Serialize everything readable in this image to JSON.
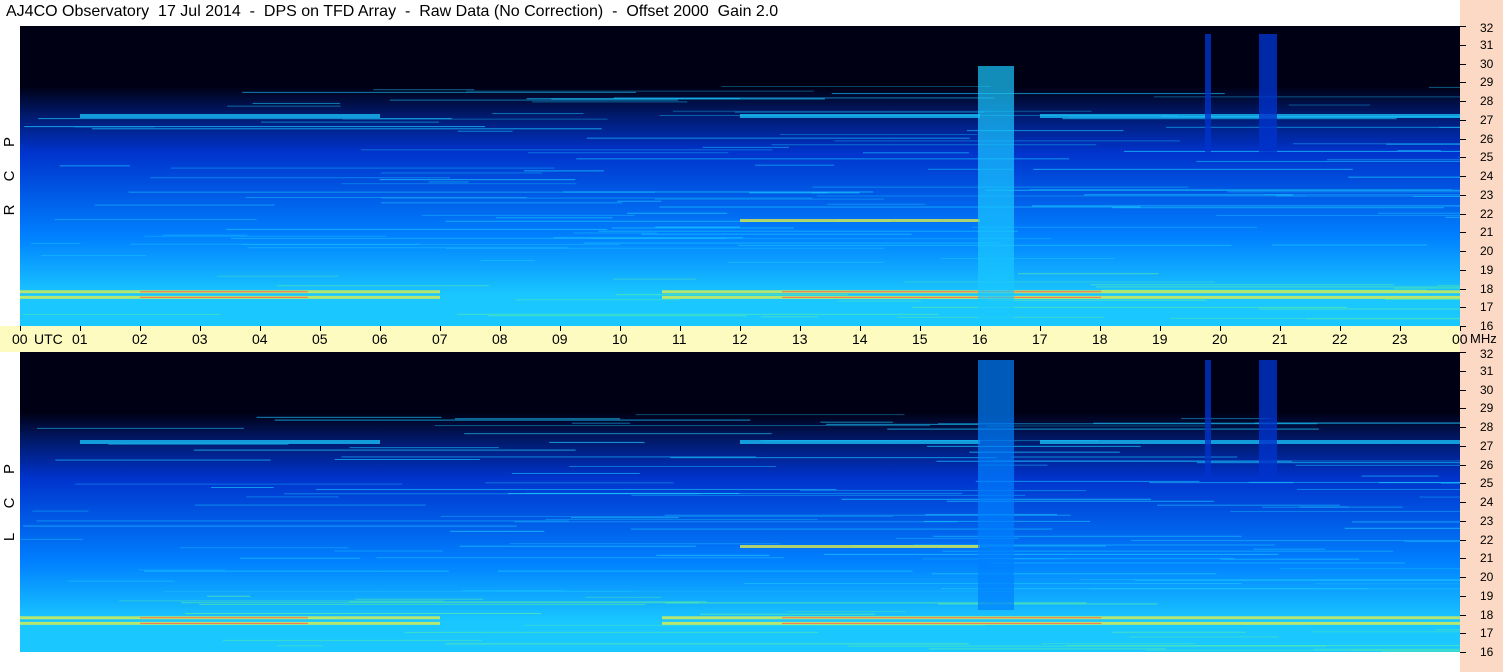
{
  "title": "AJ4CO Observatory  17 Jul 2014  -  DPS on TFD Array  -  Raw Data (No Correction)  -  Offset 2000  Gain 2.0",
  "chart_data": {
    "type": "heatmap",
    "title": "AJ4CO Observatory  17 Jul 2014  -  DPS on TFD Array  -  Raw Data (No Correction)  -  Offset 2000  Gain 2.0",
    "x_unit": "UTC",
    "y_unit": "MHz",
    "x_ticks": [
      "00",
      "01",
      "02",
      "03",
      "04",
      "05",
      "06",
      "07",
      "08",
      "09",
      "10",
      "11",
      "12",
      "13",
      "14",
      "15",
      "16",
      "17",
      "18",
      "19",
      "20",
      "21",
      "22",
      "23",
      "00"
    ],
    "y_ticks": [
      16,
      17,
      18,
      19,
      20,
      21,
      22,
      23,
      24,
      25,
      26,
      27,
      28,
      29,
      30,
      31,
      32
    ],
    "ylim": [
      16,
      32
    ],
    "xlim_hours": [
      0,
      24
    ],
    "panels": [
      {
        "name": "RCP",
        "letters": [
          "P",
          "C",
          "R"
        ]
      },
      {
        "name": "LCP",
        "letters": [
          "P",
          "C",
          "L"
        ]
      }
    ],
    "features": {
      "broadband_burst_hours": [
        16.0,
        16.5
      ],
      "narrow_burst_hours": [
        [
          19.75,
          19.85
        ],
        [
          20.65,
          20.95
        ]
      ],
      "strong_bands_mhz": [
        17.5,
        17.8,
        21.6,
        27.2
      ]
    },
    "colormap": [
      "#000014",
      "#001a6e",
      "#0033cc",
      "#0080ff",
      "#1ac8ff",
      "#5cf0a0",
      "#e8f040",
      "#ff7050",
      "#e040ff"
    ]
  },
  "axis_labels": {
    "utc": "UTC",
    "mhz": "MHz"
  }
}
